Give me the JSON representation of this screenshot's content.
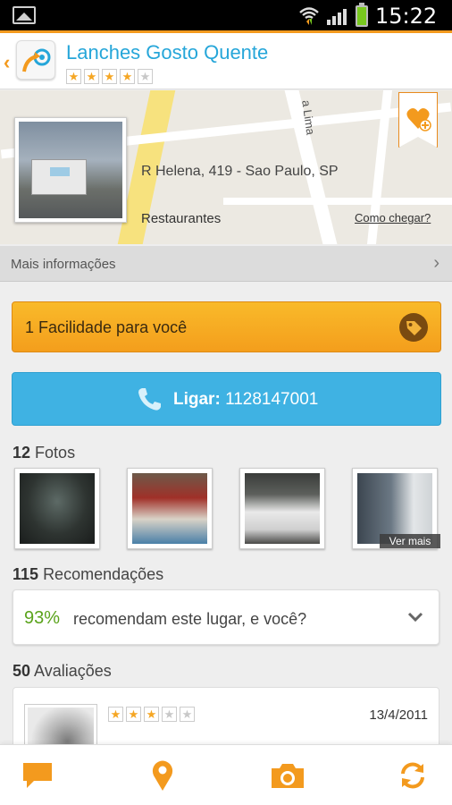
{
  "status_bar": {
    "time": "15:22",
    "icons": [
      "gallery-icon",
      "wifi-icon",
      "signal-icon",
      "battery-charging-icon"
    ]
  },
  "header": {
    "title": "Lanches Gosto Quente",
    "rating_stars": 4,
    "rating_max": 5,
    "back_icon": "chevron-left-icon",
    "logo_icon": "app-logo-icon"
  },
  "map_card": {
    "street_label": "a Lima",
    "address": "R Helena, 419  - Sao Paulo, SP",
    "category": "Restaurantes",
    "directions_link": "Como chegar?",
    "favorite_icon": "heart-plus-icon"
  },
  "more_info": {
    "label": "Mais informações",
    "icon": "chevron-right-icon"
  },
  "facility": {
    "label": "1 Facilidade para você",
    "icon": "tag-icon"
  },
  "call": {
    "prefix": "Ligar:",
    "number": "1128147001",
    "icon": "phone-icon"
  },
  "photos": {
    "count": "12",
    "label": "Fotos",
    "see_more": "Ver mais"
  },
  "recommendations": {
    "count": "115",
    "label": "Recomendações",
    "percent": "93%",
    "text": "recomendam este lugar, e você?",
    "icon": "chevron-down-icon"
  },
  "reviews": {
    "count": "50",
    "label": "Avaliações",
    "first": {
      "stars": 3,
      "stars_max": 5,
      "date": "13/4/2011"
    }
  },
  "tabbar": {
    "tabs": [
      "chat-icon",
      "location-pin-icon",
      "camera-icon",
      "refresh-icon"
    ]
  },
  "colors": {
    "accent_orange": "#f39a1e",
    "title_blue": "#26a6d9",
    "call_blue": "#3fb2e3",
    "recommend_green": "#5aa31b"
  }
}
